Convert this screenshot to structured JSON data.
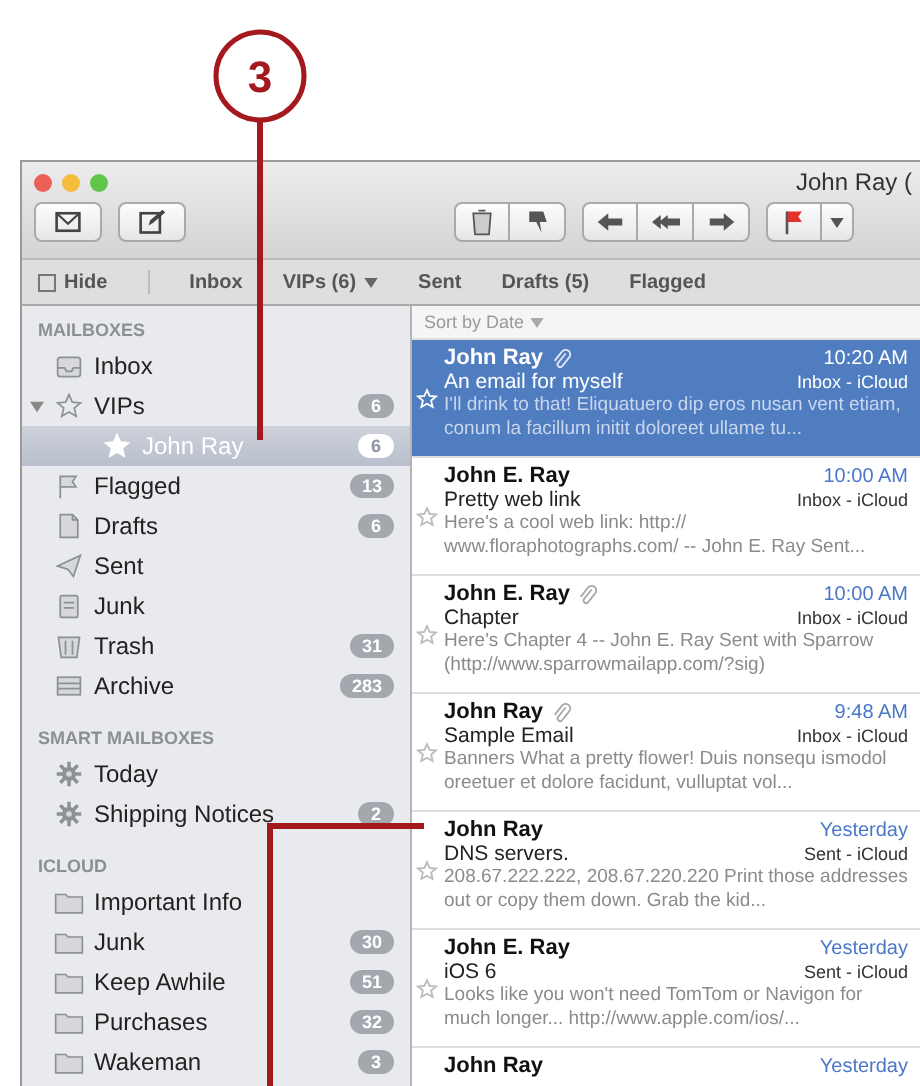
{
  "callout": {
    "label": "3"
  },
  "window": {
    "title": "John Ray ("
  },
  "favorites_bar": [
    {
      "label": "Hide",
      "kind": "hide"
    },
    {
      "label": "Inbox",
      "kind": "plain"
    },
    {
      "label": "VIPs (6)",
      "kind": "menu"
    },
    {
      "label": "Sent",
      "kind": "plain"
    },
    {
      "label": "Drafts (5)",
      "kind": "plain"
    },
    {
      "label": "Flagged",
      "kind": "plain"
    }
  ],
  "sidebar": {
    "sections": [
      {
        "title": "MAILBOXES",
        "items": [
          {
            "label": "Inbox",
            "kind": "inbox",
            "selected": false
          },
          {
            "label": "VIPs",
            "kind": "star",
            "count": "6",
            "selected": false,
            "expanded": true,
            "children": [
              {
                "label": "John Ray",
                "kind": "star",
                "count": "6",
                "selected": true
              }
            ]
          },
          {
            "label": "Flagged",
            "kind": "flag",
            "count": "13",
            "selected": false
          },
          {
            "label": "Drafts",
            "kind": "drafts",
            "count": "6",
            "selected": false
          },
          {
            "label": "Sent",
            "kind": "sent",
            "selected": false
          },
          {
            "label": "Junk",
            "kind": "junk",
            "selected": false
          },
          {
            "label": "Trash",
            "kind": "trash",
            "count": "31",
            "selected": false
          },
          {
            "label": "Archive",
            "kind": "archive",
            "count": "283",
            "selected": false
          }
        ]
      },
      {
        "title": "SMART MAILBOXES",
        "items": [
          {
            "label": "Today",
            "kind": "gear",
            "selected": false
          },
          {
            "label": "Shipping Notices",
            "kind": "gear",
            "count": "2",
            "selected": false
          }
        ]
      },
      {
        "title": "ICLOUD",
        "items": [
          {
            "label": "Important Info",
            "kind": "folder",
            "selected": false
          },
          {
            "label": "Junk",
            "kind": "folder",
            "count": "30",
            "selected": false
          },
          {
            "label": "Keep Awhile",
            "kind": "folder",
            "count": "51",
            "selected": false
          },
          {
            "label": "Purchases",
            "kind": "folder",
            "count": "32",
            "selected": false
          },
          {
            "label": "Wakeman",
            "kind": "folder",
            "count": "3",
            "selected": false
          }
        ]
      }
    ]
  },
  "message_list": {
    "sort": "Sort by Date",
    "messages": [
      {
        "from": "John Ray",
        "attachment": true,
        "time": "10:20 AM",
        "subject": "An email for myself",
        "mailbox": "Inbox - iCloud",
        "preview": "I'll drink to that! Eliquatuero dip eros nusan vent etiam, conum la facillum initit doloreet ullame tu...",
        "selected": true
      },
      {
        "from": "John E. Ray",
        "attachment": false,
        "time": "10:00 AM",
        "subject": "Pretty web link",
        "mailbox": "Inbox - iCloud",
        "preview": "Here's a cool web link: http:// www.floraphotographs.com/ -- John E. Ray Sent...",
        "selected": false
      },
      {
        "from": "John E. Ray",
        "attachment": true,
        "time": "10:00 AM",
        "subject": "Chapter",
        "mailbox": "Inbox - iCloud",
        "preview": "Here's Chapter 4 -- John E. Ray Sent with Sparrow (http://www.sparrowmailapp.com/?sig)",
        "selected": false
      },
      {
        "from": "John Ray",
        "attachment": true,
        "time": "9:48 AM",
        "subject": "Sample Email",
        "mailbox": "Inbox - iCloud",
        "preview": "Banners What a pretty flower! Duis nonsequ ismodol oreetuer et dolore facidunt, vulluptat vol...",
        "selected": false
      },
      {
        "from": "John Ray",
        "attachment": false,
        "time": "Yesterday",
        "subject": "DNS servers.",
        "mailbox": "Sent - iCloud",
        "preview": "208.67.222.222, 208.67.220.220 Print those addresses out or copy them down. Grab the kid...",
        "selected": false
      },
      {
        "from": "John E. Ray",
        "attachment": false,
        "time": "Yesterday",
        "subject": "iOS 6",
        "mailbox": "Sent - iCloud",
        "preview": "Looks like you won't need TomTom or Navigon for much longer... http://www.apple.com/ios/...",
        "selected": false
      },
      {
        "from": "John Ray",
        "attachment": false,
        "time": "Yesterday",
        "selected": false
      }
    ]
  }
}
